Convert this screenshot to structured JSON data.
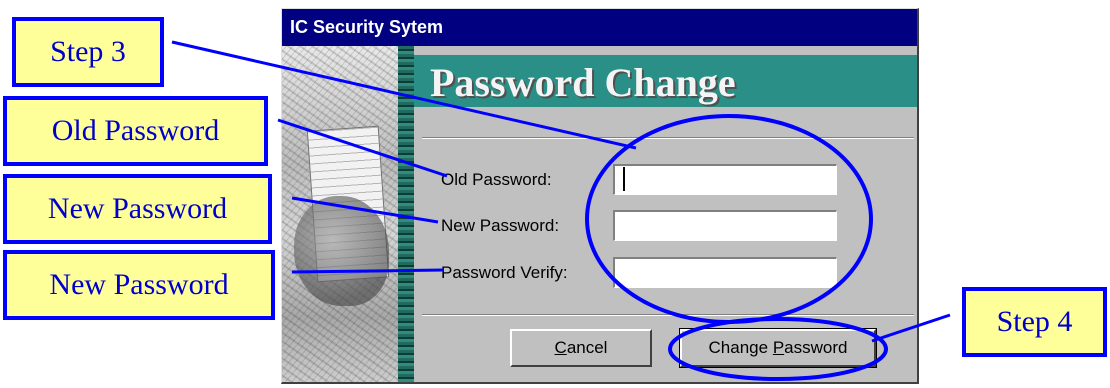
{
  "window": {
    "title": "IC Security Sytem"
  },
  "dialog": {
    "heading": "Password Change"
  },
  "fields": [
    {
      "label": "Old Password:",
      "value": "",
      "placeholder": ""
    },
    {
      "label": "New Password:",
      "value": "",
      "placeholder": ""
    },
    {
      "label": "Password Verify:",
      "value": "",
      "placeholder": ""
    }
  ],
  "buttons": {
    "cancel": {
      "underlined": "C",
      "rest": "ancel"
    },
    "change": {
      "prefix": "Change ",
      "underlined": "P",
      "rest": "assword"
    }
  },
  "callouts": {
    "step3": "Step 3",
    "old_password": "Old Password",
    "new_password": "New Password",
    "verify_password": "New Password",
    "step4": "Step 4"
  },
  "colors": {
    "titlebar": "#000080",
    "header_band": "#2a8f86",
    "dialog_bg": "#c0c0c0",
    "callout_bg": "#ffff99",
    "callout_border": "#0000ff",
    "annotation": "#0000ff"
  },
  "icons": {
    "side_art": "security-collage-image"
  }
}
